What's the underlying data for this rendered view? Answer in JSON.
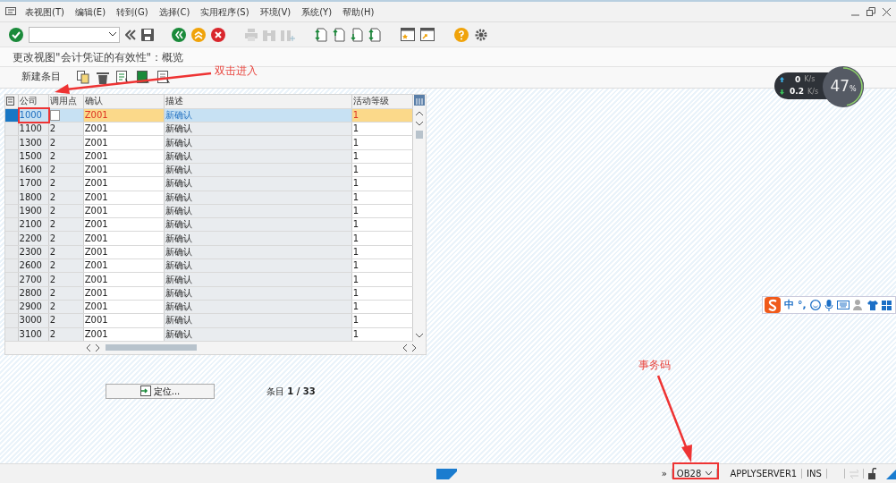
{
  "menu": [
    "表视图(T)",
    "编辑(E)",
    "转到(G)",
    "选择(C)",
    "实用程序(S)",
    "环境(V)",
    "系统(Y)",
    "帮助(H)"
  ],
  "screen_title": "更改视图\"会计凭证的有效性\"：概览",
  "app_toolbar": {
    "new_entries": "新建条目"
  },
  "table": {
    "columns": [
      "公司",
      "调用点",
      "确认",
      "描述",
      "活动等级"
    ],
    "rows": [
      {
        "cells": [
          "1000",
          "",
          "Z001",
          "新确认",
          "1"
        ],
        "selected": true
      },
      {
        "cells": [
          "1100",
          "2",
          "Z001",
          "新确认",
          "1"
        ],
        "selected": false
      },
      {
        "cells": [
          "1300",
          "2",
          "Z001",
          "新确认",
          "1"
        ],
        "selected": false
      },
      {
        "cells": [
          "1500",
          "2",
          "Z001",
          "新确认",
          "1"
        ],
        "selected": false
      },
      {
        "cells": [
          "1600",
          "2",
          "Z001",
          "新确认",
          "1"
        ],
        "selected": false
      },
      {
        "cells": [
          "1700",
          "2",
          "Z001",
          "新确认",
          "1"
        ],
        "selected": false
      },
      {
        "cells": [
          "1800",
          "2",
          "Z001",
          "新确认",
          "1"
        ],
        "selected": false
      },
      {
        "cells": [
          "1900",
          "2",
          "Z001",
          "新确认",
          "1"
        ],
        "selected": false
      },
      {
        "cells": [
          "2100",
          "2",
          "Z001",
          "新确认",
          "1"
        ],
        "selected": false
      },
      {
        "cells": [
          "2200",
          "2",
          "Z001",
          "新确认",
          "1"
        ],
        "selected": false
      },
      {
        "cells": [
          "2300",
          "2",
          "Z001",
          "新确认",
          "1"
        ],
        "selected": false
      },
      {
        "cells": [
          "2600",
          "2",
          "Z001",
          "新确认",
          "1"
        ],
        "selected": false
      },
      {
        "cells": [
          "2700",
          "2",
          "Z001",
          "新确认",
          "1"
        ],
        "selected": false
      },
      {
        "cells": [
          "2800",
          "2",
          "Z001",
          "新确认",
          "1"
        ],
        "selected": false
      },
      {
        "cells": [
          "2900",
          "2",
          "Z001",
          "新确认",
          "1"
        ],
        "selected": false
      },
      {
        "cells": [
          "3000",
          "2",
          "Z001",
          "新确认",
          "1"
        ],
        "selected": false
      },
      {
        "cells": [
          "3100",
          "2",
          "Z001",
          "新确认",
          "1"
        ],
        "selected": false
      }
    ]
  },
  "position_button": "定位...",
  "entry_counter": "条目 **1 / 33**",
  "speed_widget": {
    "upload": "0",
    "upload_unit": "K/s",
    "download": "0.2",
    "download_unit": "K/s",
    "percent": "47",
    "percent_sign": "%",
    "level": 0.47
  },
  "ime_toolbar": {
    "mode": "中",
    "punctuation": "°,"
  },
  "status_bar": {
    "expand": "»",
    "transaction": "OB28",
    "server": "APPLYSERVER1",
    "mode": "INS"
  },
  "annotations": [
    {
      "text": "双击进入"
    },
    {
      "text": "事务码"
    }
  ]
}
